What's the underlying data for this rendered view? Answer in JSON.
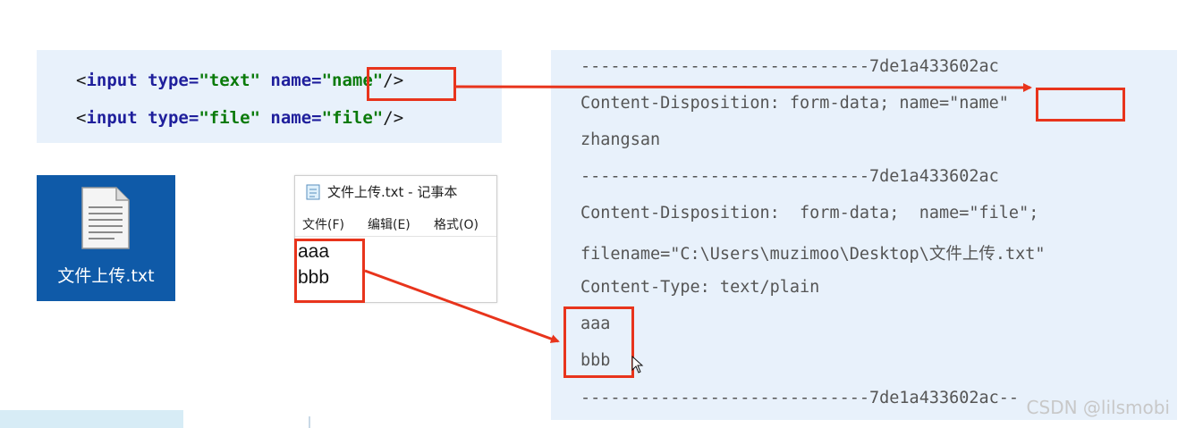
{
  "html_code": {
    "line1": {
      "open": "<",
      "tag": "input",
      "type_attr": "type=",
      "type_val": "\"text\"",
      "name_attr": "name=",
      "name_val": "\"name\"",
      "close": "/>"
    },
    "line2": {
      "open": "<",
      "tag": "input",
      "type_attr": "type=",
      "type_val": "\"file\"",
      "name_attr": "name=",
      "name_val": "\"file\"",
      "close": "/>"
    }
  },
  "file_icon": {
    "label": "文件上传.txt"
  },
  "notepad": {
    "title": "文件上传.txt - 记事本",
    "menu": [
      "文件(F)",
      "编辑(E)",
      "格式(O)"
    ],
    "content": [
      "aaa",
      "bbb"
    ]
  },
  "request_body": {
    "boundary1": "-----------------------------7de1a433602ac",
    "disposition1_prefix": "Content-Disposition: form-data; name=",
    "disposition1_name": "\"name\"",
    "value1": "zhangsan",
    "boundary2": "-----------------------------7de1a433602ac",
    "disposition2": "Content-Disposition:  form-data;  name=\"file\";",
    "filename": "filename=\"C:\\Users\\muzimoo\\Desktop\\文件上传.txt\"",
    "content_type": "Content-Type: text/plain",
    "file_lines": [
      "aaa",
      "bbb"
    ],
    "boundary3": "-----------------------------7de1a433602ac--"
  },
  "watermark": "CSDN @lilsmobi",
  "colors": {
    "highlight": "#e8341c",
    "panel_bg": "#e8f1fb",
    "tile_bg": "#0f5aa8"
  }
}
